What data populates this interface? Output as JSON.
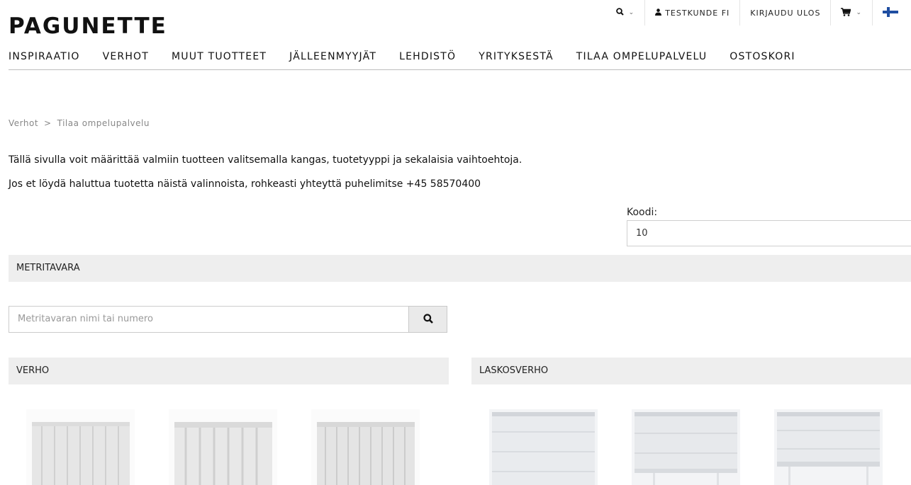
{
  "brand": {
    "logo_text": "PAGUNETTE"
  },
  "topbar": {
    "search_icon": "search-icon",
    "user_label": "TESTKUNDE FI",
    "logout_label": "KIRJAUDU ULOS",
    "cart_icon": "cart-icon",
    "language_flag": "finland-flag-icon"
  },
  "nav": {
    "items": [
      "INSPIRAATIO",
      "VERHOT",
      "MUUT TUOTTEET",
      "JÄLLEENMYYJÄT",
      "LEHDISTÖ",
      "YRITYKSESTÄ",
      "TILAA OMPELUPALVELU",
      "OSTOSKORI"
    ]
  },
  "breadcrumb": {
    "items": [
      "Verhot",
      "Tilaa ompelupalvelu"
    ],
    "separator": ">"
  },
  "intro": {
    "line1": "Tällä sivulla voit määrittää valmiin tuotteen valitsemalla kangas, tuotetyyppi ja sekalaisia vaihtoehtoja.",
    "line2": "Jos et löydä haluttua tuotetta näistä valinnoista, rohkeasti yhteyttä puhelimitse +45 58570400"
  },
  "code": {
    "label": "Koodi:",
    "value": "10"
  },
  "fabric": {
    "section_title": "METRITAVARA",
    "search_placeholder": "Metritavaran nimi tai numero"
  },
  "product_types": [
    {
      "title": "VERHO",
      "images": [
        "curtain-icon",
        "curtain-icon",
        "curtain-icon"
      ]
    },
    {
      "title": "LASKOSVERHO",
      "images": [
        "roman-blind-icon",
        "roman-blind-icon",
        "roman-blind-icon"
      ]
    }
  ],
  "colors": {
    "section_bg": "#eeeeee",
    "flag_blue": "#1f4ea1",
    "text": "#111111"
  }
}
